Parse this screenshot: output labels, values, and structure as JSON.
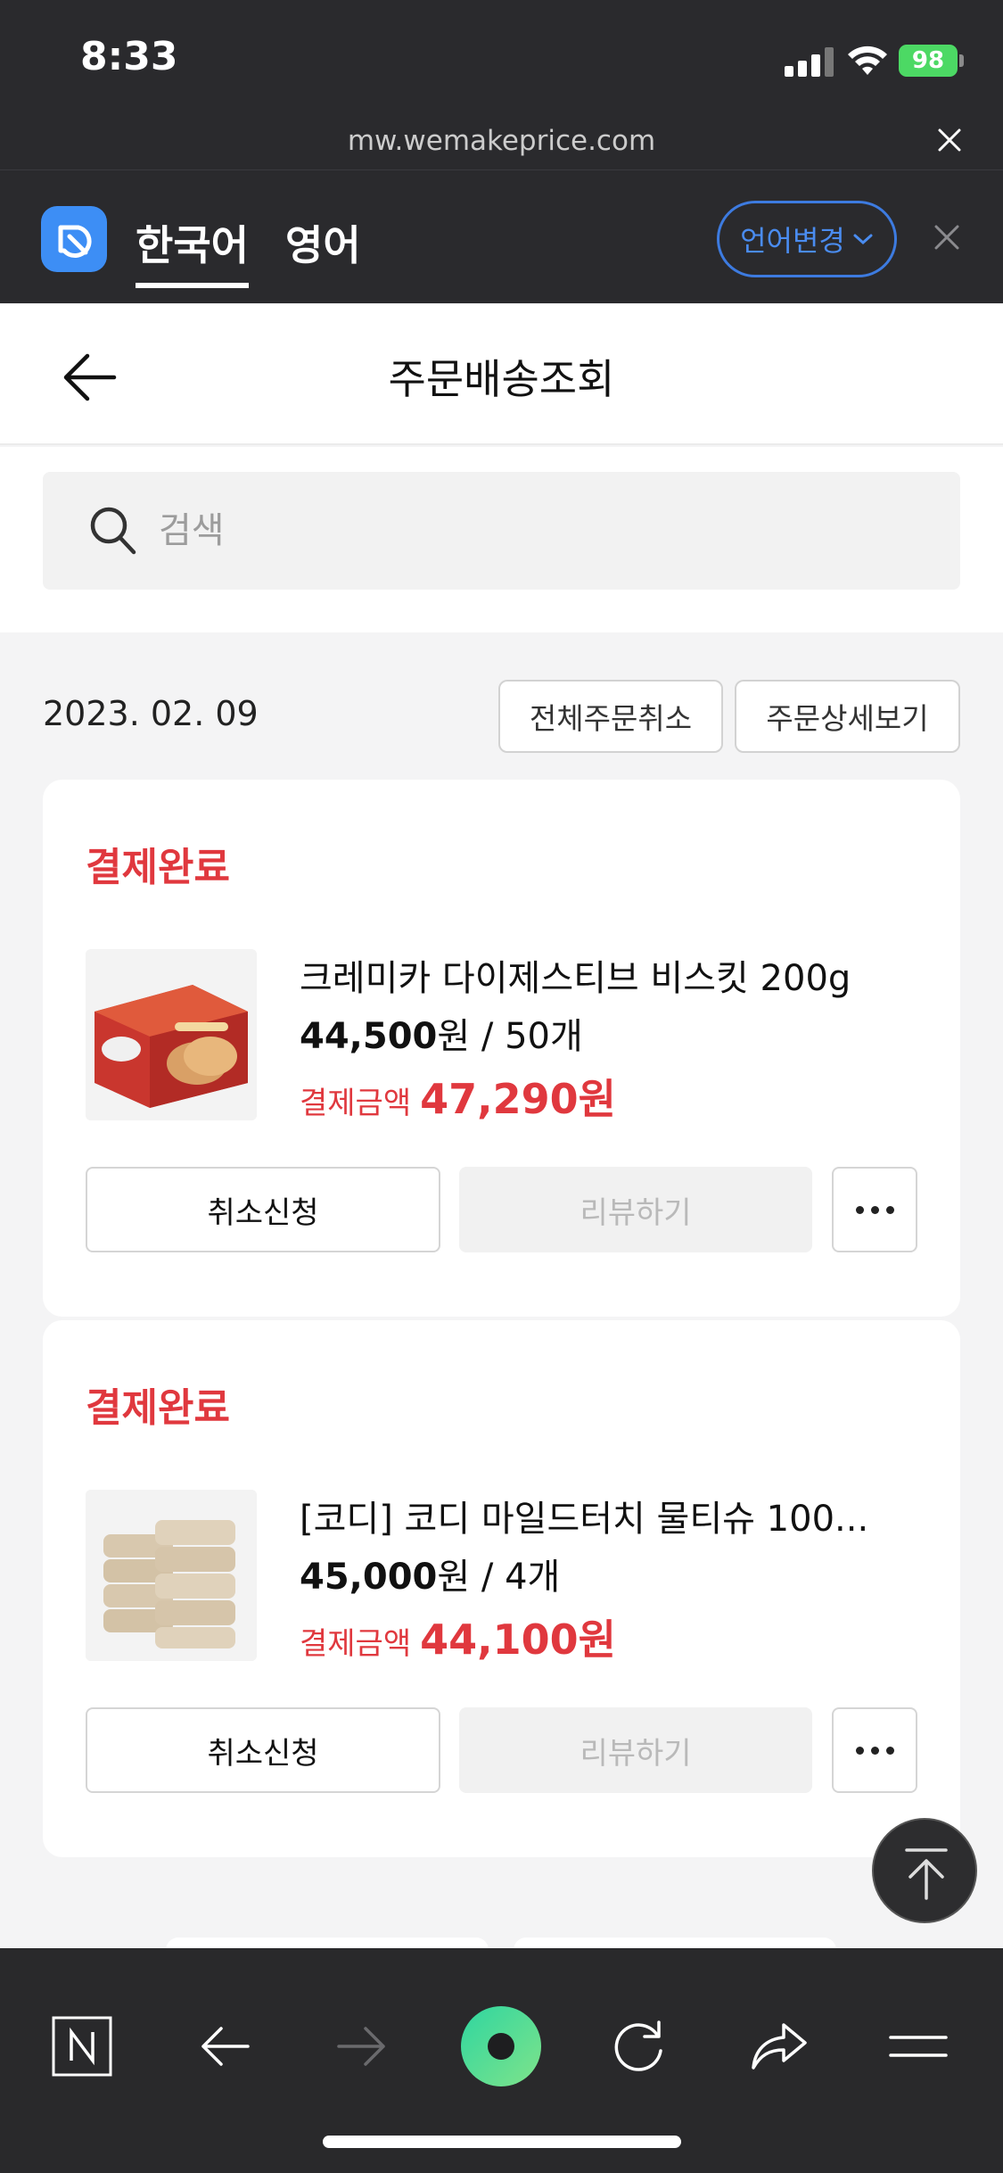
{
  "status_bar": {
    "time": "8:33",
    "battery": "98"
  },
  "browser": {
    "url": "mw.wemakeprice.com"
  },
  "translate_bar": {
    "tabs": [
      {
        "label": "한국어",
        "active": true
      },
      {
        "label": "영어",
        "active": false
      }
    ],
    "change_label": "언어변경"
  },
  "header": {
    "title": "주문배송조회"
  },
  "search": {
    "placeholder": "검색"
  },
  "order": {
    "date": "2023. 02. 09",
    "cancel_all_label": "전체주문취소",
    "detail_label": "주문상세보기",
    "items": [
      {
        "status": "결제완료",
        "name": "크레미카 다이제스티브 비스킷 200g",
        "price": "44,500",
        "price_unit": "원",
        "quantity": "/ 50개",
        "paid_label": "결제금액",
        "paid_amount": "47,290원",
        "cancel_label": "취소신청",
        "review_label": "리뷰하기"
      },
      {
        "status": "결제완료",
        "name": "[코디] 코디 마일드터치 물티슈 100...",
        "price": "45,000",
        "price_unit": "원",
        "quantity": "/ 4개",
        "paid_label": "결제금액",
        "paid_amount": "44,100원",
        "cancel_label": "취소신청",
        "review_label": "리뷰하기"
      }
    ]
  },
  "colors": {
    "status_red": "#e0383e",
    "accent_blue": "#3d8ef5",
    "dark_bar": "#2a2a2d",
    "green_button": "#3fd39a"
  },
  "icons": [
    "signal-icon",
    "wifi-icon",
    "battery-icon",
    "close-icon",
    "papago-logo",
    "chevron-down-icon",
    "back-arrow-icon",
    "search-icon",
    "more-icon",
    "arrow-up-icon",
    "naver-n-icon",
    "back-icon",
    "forward-icon",
    "green-dot-icon",
    "refresh-icon",
    "share-icon",
    "menu-icon"
  ]
}
